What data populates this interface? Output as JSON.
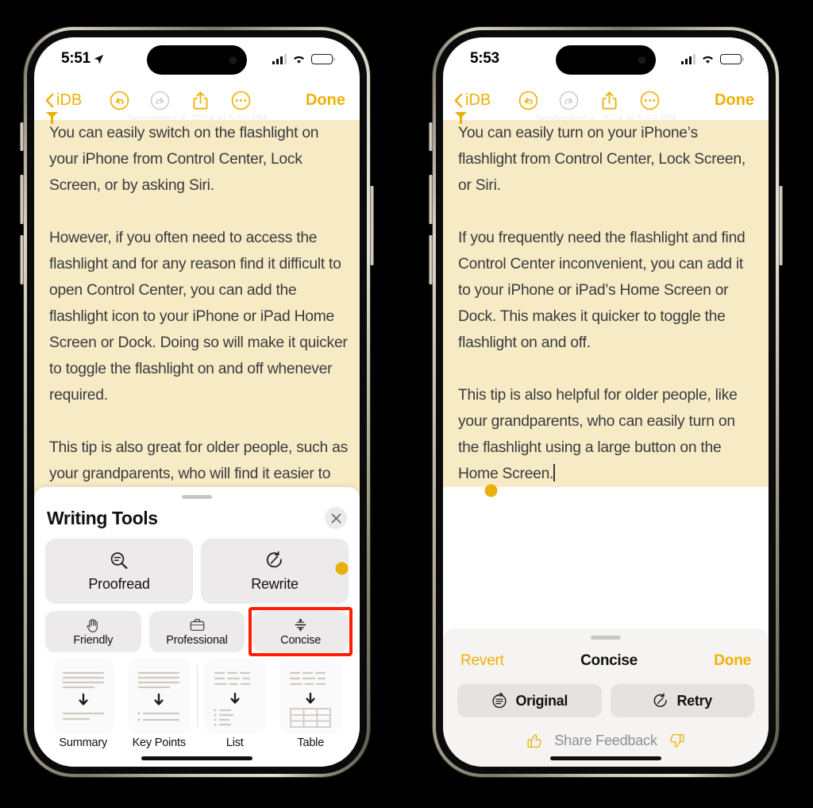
{
  "left_phone": {
    "status_bar": {
      "time": "5:51",
      "location_icon": "location-arrow-icon",
      "cellular_icon": "cellular-bars-icon",
      "wifi_icon": "wifi-icon",
      "battery_icon": "battery-icon"
    },
    "nav_bar": {
      "back_label": "iDB",
      "back_icon": "chevron-left-icon",
      "undo_icon": "undo-icon",
      "redo_icon": "redo-icon",
      "share_icon": "share-icon",
      "more_icon": "ellipsis-circle-icon",
      "done_label": "Done"
    },
    "ghost_date": "September 4, 2024 at 5:51 PM",
    "note": {
      "paragraphs": [
        "You can easily switch on the flashlight on your iPhone from Control Center, Lock Screen, or by asking Siri.",
        "However, if you often need to access the flashlight and for any reason find it difficult to open Control Center, you can add the flashlight icon to your iPhone or iPad Home Screen or Dock. Doing so will make it quicker to toggle the flashlight on and off whenever required.",
        "This tip is also great for older people, such as your grandparents, who will find it easier to turn on the flashlight using a massive button on the Home Screen, as opposed to other methods."
      ],
      "highlight_color": "#F7EBC6",
      "selection_handle_color": "#E8B00B"
    },
    "writing_tools": {
      "title": "Writing Tools",
      "close_icon": "close-icon",
      "primary": [
        {
          "label": "Proofread",
          "icon": "proofread-magnifier-icon"
        },
        {
          "label": "Rewrite",
          "icon": "rewrite-dial-icon"
        }
      ],
      "tones": [
        {
          "label": "Friendly",
          "icon": "waving-hand-icon"
        },
        {
          "label": "Professional",
          "icon": "briefcase-icon"
        },
        {
          "label": "Concise",
          "icon": "concise-arrows-icon",
          "highlighted": true
        }
      ],
      "highlight_box_color": "#FF1E04",
      "formats": [
        {
          "label": "Summary",
          "icon": "summary-tile-icon"
        },
        {
          "label": "Key Points",
          "icon": "key-points-tile-icon"
        },
        {
          "label": "List",
          "icon": "list-tile-icon"
        },
        {
          "label": "Table",
          "icon": "table-tile-icon"
        }
      ]
    }
  },
  "right_phone": {
    "status_bar": {
      "time": "5:53",
      "cellular_icon": "cellular-bars-icon",
      "wifi_icon": "wifi-icon",
      "battery_icon": "battery-icon"
    },
    "nav_bar": {
      "back_label": "iDB",
      "back_icon": "chevron-left-icon",
      "undo_icon": "undo-icon",
      "redo_icon": "redo-icon",
      "share_icon": "share-icon",
      "more_icon": "ellipsis-circle-icon",
      "done_label": "Done"
    },
    "ghost_date": "September 4, 2024 at 5:53 PM",
    "note": {
      "paragraphs": [
        "You can easily turn on your iPhone’s flashlight from Control Center, Lock Screen, or Siri.",
        "If you frequently need the flashlight and find Control Center inconvenient, you can add it to your iPhone or iPad’s Home Screen or Dock. This makes it quicker to toggle the flashlight on and off.",
        "This tip is also helpful for older people, like your grandparents, who can easily turn on the flashlight using a large button on the Home Screen."
      ],
      "highlight_color": "#F7EBC6",
      "selection_handle_color": "#E8B00B"
    },
    "result_bar": {
      "revert_label": "Revert",
      "title": "Concise",
      "done_label": "Done",
      "actions": [
        {
          "label": "Original",
          "icon": "original-revert-icon"
        },
        {
          "label": "Retry",
          "icon": "retry-dial-icon"
        }
      ],
      "feedback_label": "Share Feedback",
      "thumbs_up_icon": "thumbs-up-icon",
      "thumbs_down_icon": "thumbs-down-icon"
    }
  },
  "theme": {
    "accent": "#EFB007",
    "highlight": "#F7EBC6",
    "marker_red": "#FF1E04",
    "text": "#3a3a3c"
  }
}
